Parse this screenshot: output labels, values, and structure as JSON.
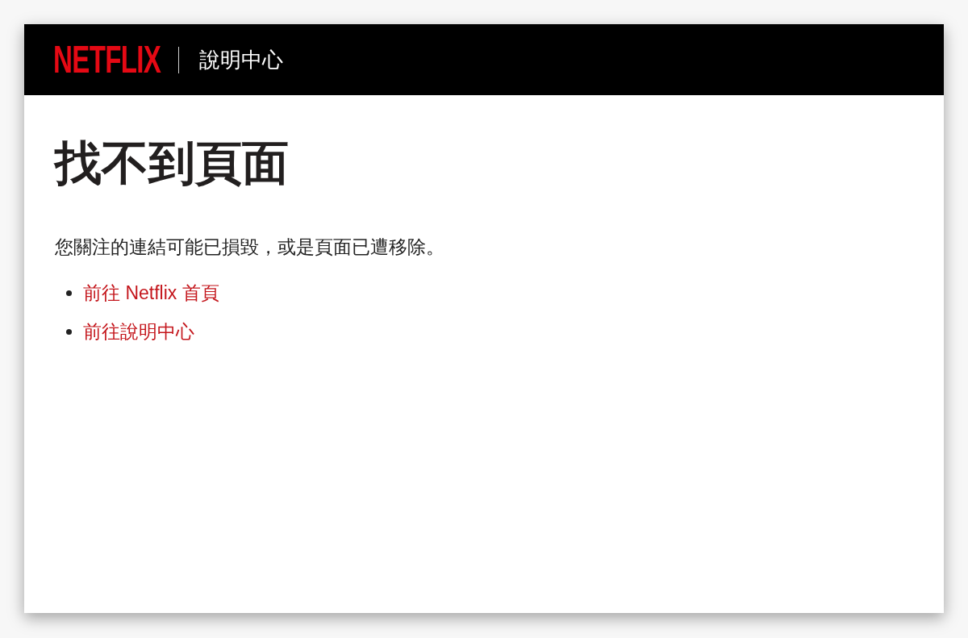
{
  "header": {
    "logo": "NETFLIX",
    "section_title": "說明中心"
  },
  "content": {
    "title": "找不到頁面",
    "message": "您關注的連結可能已損毀，或是頁面已遭移除。",
    "links": [
      "前往 Netflix 首頁",
      "前往說明中心"
    ]
  }
}
